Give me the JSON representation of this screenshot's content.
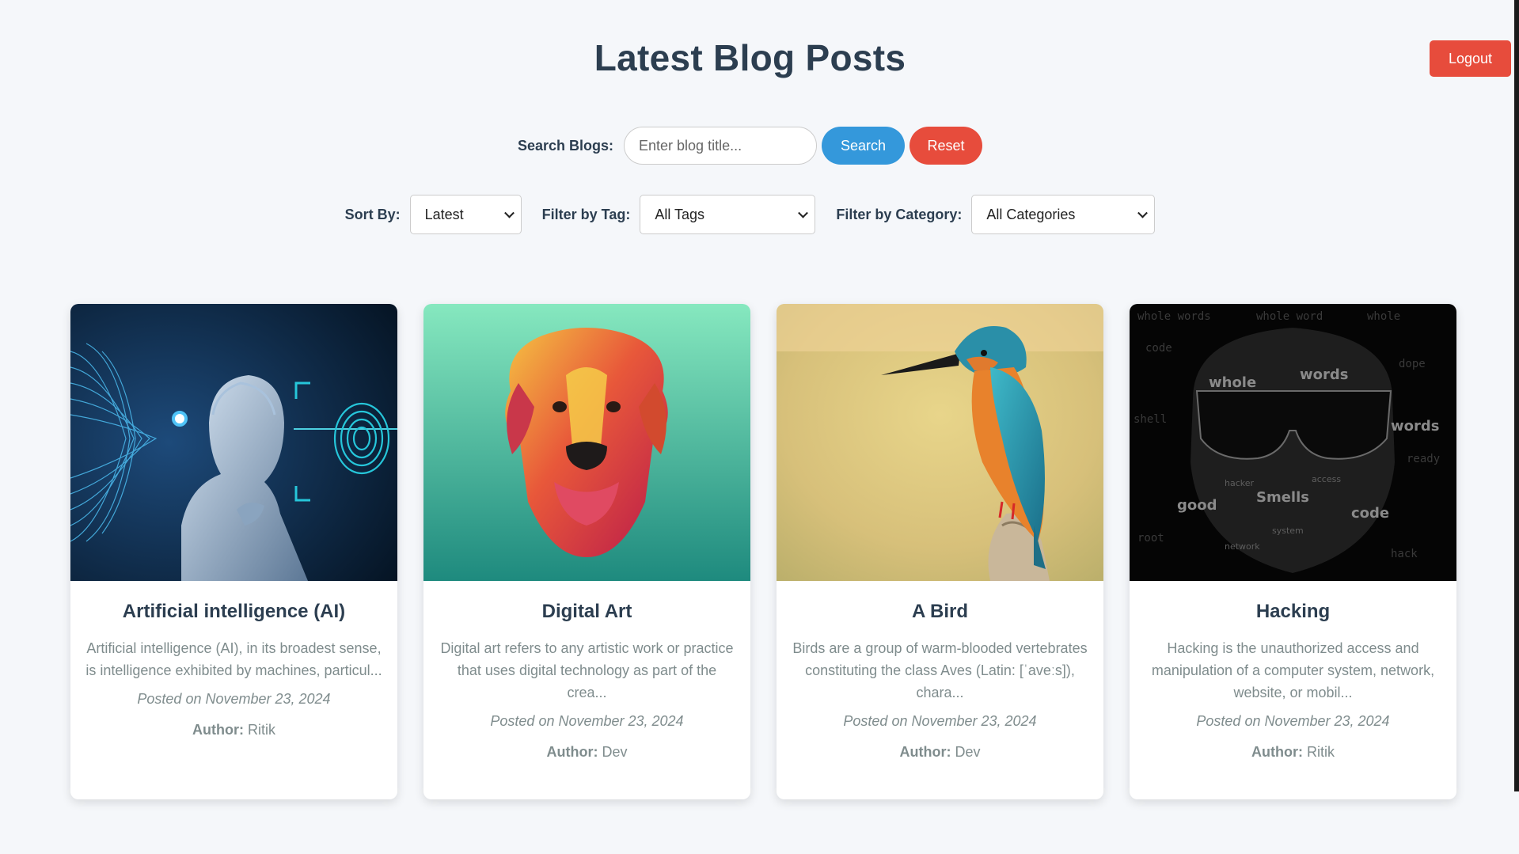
{
  "header": {
    "title": "Latest Blog Posts",
    "logout_label": "Logout"
  },
  "search": {
    "label": "Search Blogs:",
    "placeholder": "Enter blog title...",
    "search_label": "Search",
    "reset_label": "Reset"
  },
  "filters": {
    "sort_label": "Sort By:",
    "sort_value": "Latest",
    "tag_label": "Filter by Tag:",
    "tag_value": "All Tags",
    "category_label": "Filter by Category:",
    "category_value": "All Categories"
  },
  "posts": [
    {
      "title": "Artificial intelligence (AI)",
      "excerpt": "Artificial intelligence (AI), in its broadest sense, is intelligence exhibited by machines, particul...",
      "date": "Posted on November 23, 2024",
      "author_label": "Author:",
      "author": "Ritik",
      "image": "ai-robot-fingerprint"
    },
    {
      "title": "Digital Art",
      "excerpt": "Digital art refers to any artistic work or practice that uses digital technology as part of the crea...",
      "date": "Posted on November 23, 2024",
      "author_label": "Author:",
      "author": "Dev",
      "image": "colorful-dog-portrait"
    },
    {
      "title": "A Bird",
      "excerpt": "Birds are a group of warm-blooded vertebrates constituting the class Aves (Latin: [ˈaveːs]), chara...",
      "date": "Posted on November 23, 2024",
      "author_label": "Author:",
      "author": "Dev",
      "image": "kingfisher-bird"
    },
    {
      "title": "Hacking",
      "excerpt": "Hacking is the unauthorized access and manipulation of a computer system, network, website, or mobil...",
      "date": "Posted on November 23, 2024",
      "author_label": "Author:",
      "author": "Ritik",
      "image": "hacker-word-art"
    }
  ],
  "colors": {
    "background": "#f5f7fa",
    "heading": "#2c3e50",
    "primary": "#3498db",
    "danger": "#e74c3c",
    "muted": "#7f8c8d"
  }
}
